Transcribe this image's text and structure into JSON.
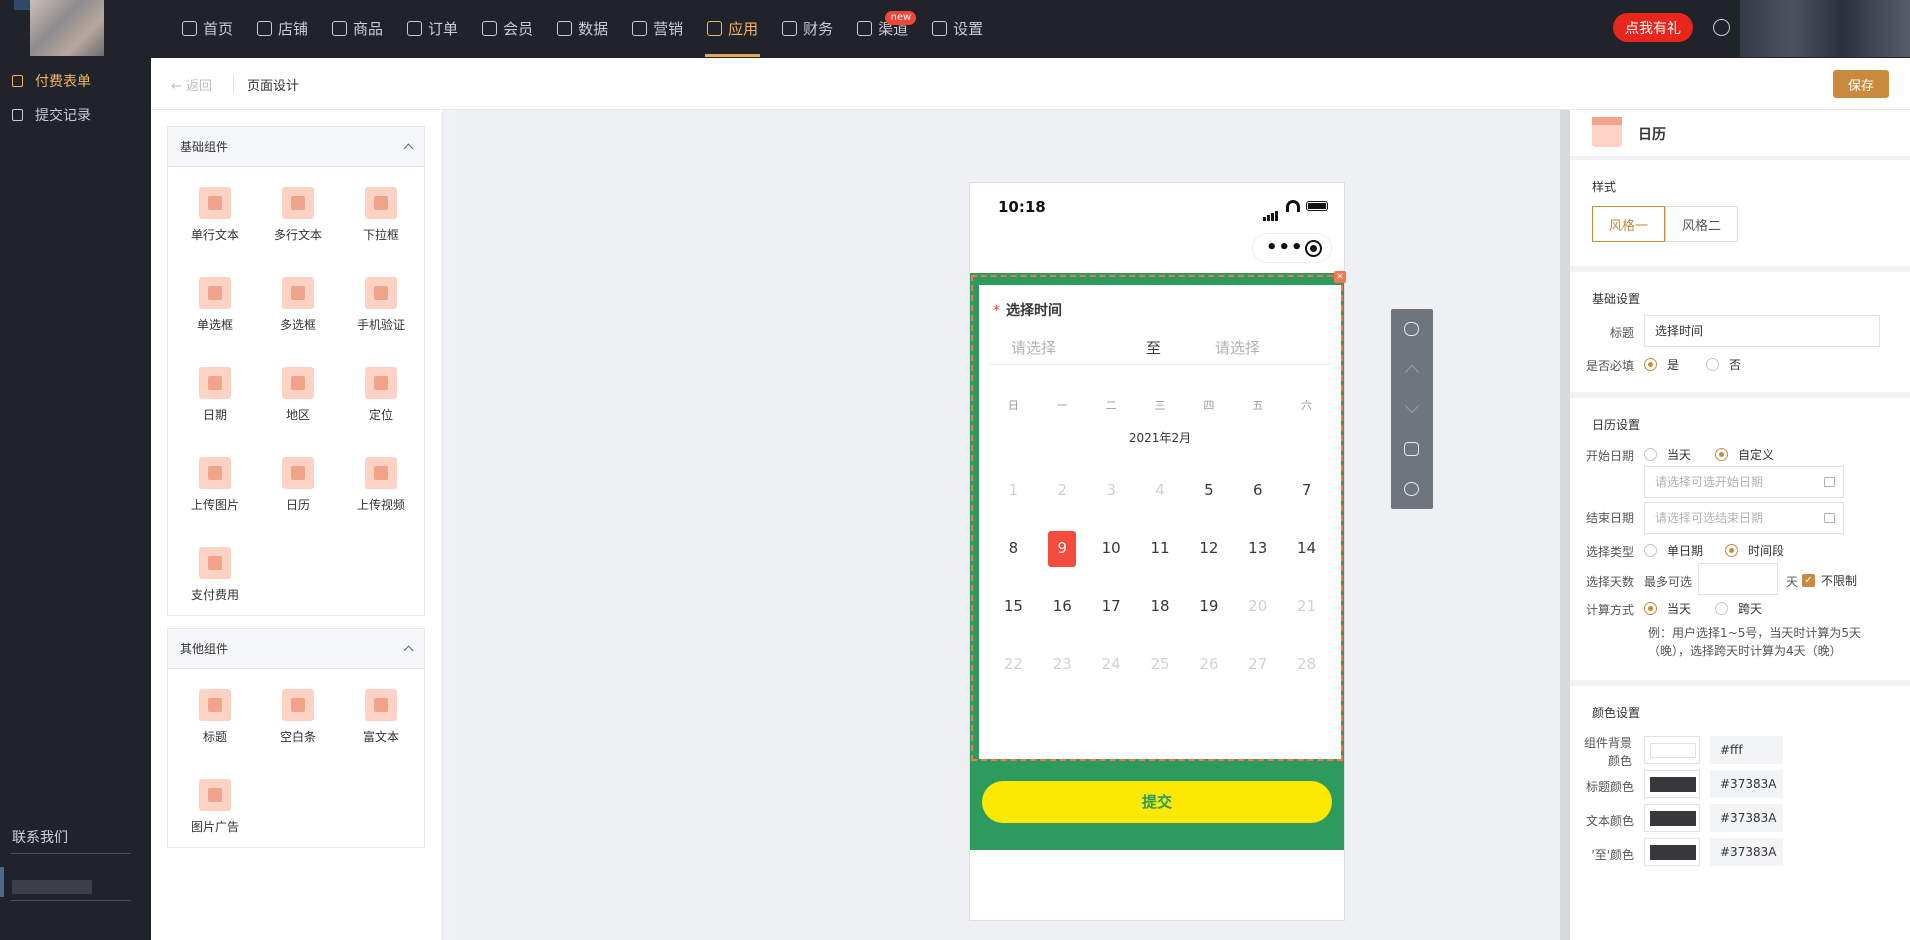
{
  "topbar": {
    "nav": [
      {
        "label": "首页",
        "icon": "home-icon"
      },
      {
        "label": "店铺",
        "icon": "store-icon"
      },
      {
        "label": "商品",
        "icon": "product-icon"
      },
      {
        "label": "订单",
        "icon": "order-icon"
      },
      {
        "label": "会员",
        "icon": "member-icon"
      },
      {
        "label": "数据",
        "icon": "chart-icon"
      },
      {
        "label": "营销",
        "icon": "tag-icon"
      },
      {
        "label": "应用",
        "icon": "app-icon",
        "active": true
      },
      {
        "label": "财务",
        "icon": "finance-icon"
      },
      {
        "label": "渠道",
        "icon": "channel-icon",
        "badge": "new"
      },
      {
        "label": "设置",
        "icon": "settings-icon"
      }
    ],
    "gift_button": "点我有礼"
  },
  "sidebar": {
    "items": [
      {
        "label": "付费表单",
        "active": true
      },
      {
        "label": "提交记录"
      }
    ],
    "contact": "联系我们"
  },
  "page": {
    "back": "返回",
    "title": "页面设计",
    "save": "保存"
  },
  "components": {
    "basic_title": "基础组件",
    "basic": [
      "单行文本",
      "多行文本",
      "下拉框",
      "单选框",
      "多选框",
      "手机验证",
      "日期",
      "地区",
      "定位",
      "上传图片",
      "日历",
      "上传视频",
      "支付费用"
    ],
    "other_title": "其他组件",
    "other": [
      "标题",
      "空白条",
      "富文本",
      "图片广告"
    ]
  },
  "phone": {
    "time": "10:18",
    "field_title": "选择时间",
    "required_mark": "*",
    "start_placeholder": "请选择",
    "end_placeholder": "请选择",
    "to": "至",
    "weekdays": [
      "日",
      "一",
      "二",
      "三",
      "四",
      "五",
      "六"
    ],
    "month": "2021年2月",
    "weeks": [
      [
        "1",
        "2",
        "3",
        "4",
        "5",
        "6",
        "7"
      ],
      [
        "8",
        "9",
        "10",
        "11",
        "12",
        "13",
        "14"
      ],
      [
        "15",
        "16",
        "17",
        "18",
        "19",
        "20",
        "21"
      ],
      [
        "22",
        "23",
        "24",
        "25",
        "26",
        "27",
        "28"
      ]
    ],
    "selected_day": "9",
    "submit": "提交"
  },
  "settings": {
    "component_name": "日历",
    "style_section": "样式",
    "style1": "风格一",
    "style2": "风格二",
    "basic_section": "基础设置",
    "title_label": "标题",
    "title_value": "选择时间",
    "required_label": "是否必填",
    "yes": "是",
    "no": "否",
    "calendar_section": "日历设置",
    "start_label": "开始日期",
    "today": "当天",
    "custom": "自定义",
    "start_placeholder": "请选择可选开始日期",
    "end_label": "结束日期",
    "end_placeholder": "请选择可选结束日期",
    "type_label": "选择类型",
    "single": "单日期",
    "period": "时间段",
    "days_label": "选择天数",
    "max_label": "最多可选",
    "day_unit": "天",
    "unlimited": "不限制",
    "calc_label": "计算方式",
    "calc_today": "当天",
    "calc_cross": "跨天",
    "example": "例：用户选择1~5号，当天时计算为5天（晚），选择跨天时计算为4天（晚）",
    "color_section": "颜色设置",
    "bg_label": "组件背景颜色",
    "bg_hex": "#fff",
    "title_color_label": "标题颜色",
    "title_hex": "#37383A",
    "text_color_label": "文本颜色",
    "text_hex": "#37383A",
    "to_color_label": "'至'颜色",
    "to_hex": "#37383A"
  }
}
